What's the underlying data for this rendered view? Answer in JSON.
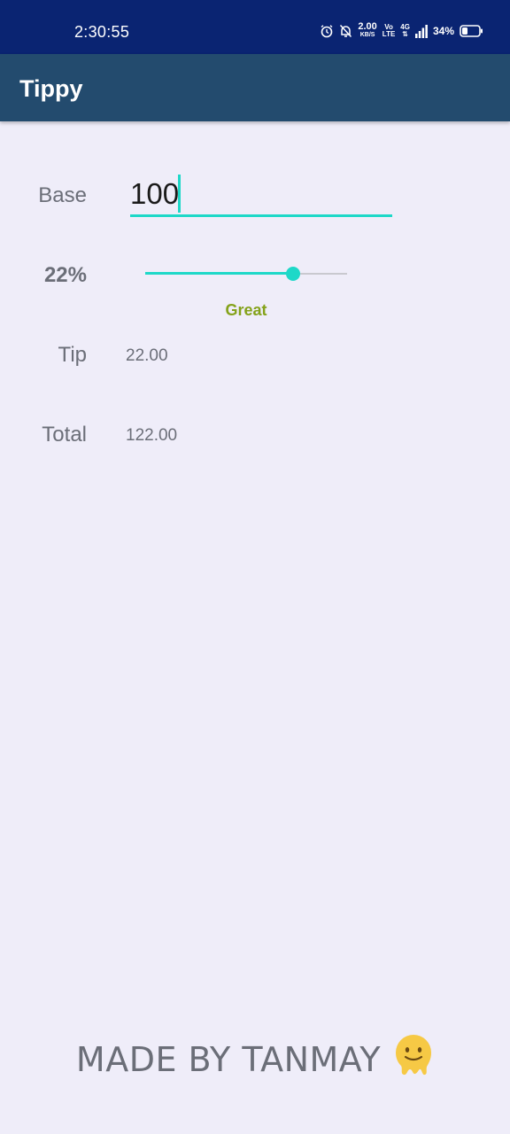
{
  "status_bar": {
    "time": "2:30:55",
    "net_speed": "2.00",
    "net_speed_unit": "KB/S",
    "volte_top": "Vo",
    "volte_bottom": "LTE",
    "network_type": "4G",
    "battery_percent": "34%",
    "battery_level": 0.34
  },
  "app_bar": {
    "title": "Tippy"
  },
  "calculator": {
    "base_label": "Base",
    "base_value": "100",
    "percent_label": "22%",
    "tip_percent": 22,
    "tip_percent_max": 30,
    "tip_description": "Great",
    "tip_label": "Tip",
    "tip_value": "22.00",
    "total_label": "Total",
    "total_value": "122.00"
  },
  "footer": {
    "text": "MADE BY TANMAY",
    "emoji": "🫠"
  },
  "colors": {
    "status_bar": "#0A2472",
    "app_bar": "#234B6E",
    "accent": "#1ED8C8",
    "description": "#84A21A",
    "background": "#EFEDF9"
  }
}
